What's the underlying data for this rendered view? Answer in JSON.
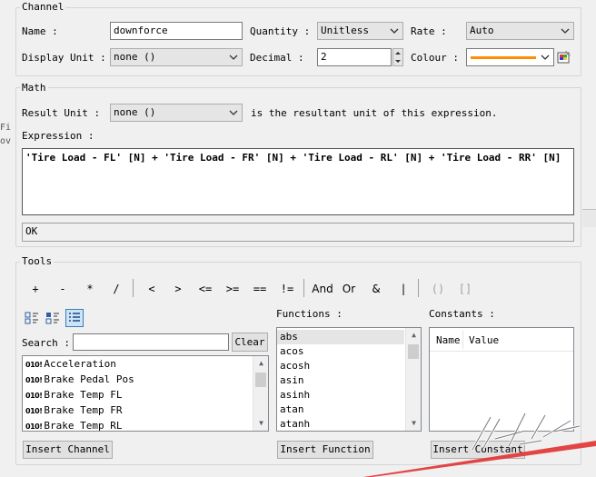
{
  "channel": {
    "group_title": "Channel",
    "name_label": "Name :",
    "name_value": "downforce",
    "quantity_label": "Quantity :",
    "quantity_value": "Unitless",
    "rate_label": "Rate :",
    "rate_value": "Auto",
    "display_unit_label": "Display Unit :",
    "display_unit_value": "none ()",
    "decimal_label": "Decimal :",
    "decimal_value": "2",
    "colour_label": "Colour :",
    "colour_value": "#ff8c00"
  },
  "math": {
    "group_title": "Math",
    "result_unit_label": "Result Unit :",
    "result_unit_value": "none ()",
    "result_unit_suffix": "is the resultant unit of this expression.",
    "expression_label": "Expression :",
    "expression_value": "'Tire Load - FL' [N] + 'Tire Load - FR' [N] + 'Tire Load - RL' [N] + 'Tire Load - RR' [N]",
    "status_value": "OK"
  },
  "tools": {
    "group_title": "Tools",
    "operators": [
      "+",
      "-",
      "*",
      "/",
      "<",
      ">",
      "<=",
      ">=",
      "==",
      "!=",
      "And",
      "Or",
      "&",
      "|",
      "()",
      "[]"
    ],
    "search_label": "Search :",
    "search_value": "",
    "clear_label": "Clear",
    "channels": [
      "Acceleration",
      "Brake Pedal Pos",
      "Brake Temp FL",
      "Brake Temp FR",
      "Brake Temp RL"
    ],
    "channel_icon_text": "010!",
    "insert_channel_label": "Insert Channel",
    "functions_label": "Functions :",
    "functions": [
      "abs",
      "acos",
      "acosh",
      "asin",
      "asinh",
      "atan",
      "atanh"
    ],
    "insert_function_label": "Insert Function",
    "constants_label": "Constants :",
    "constants_headers": [
      "Name",
      "Value"
    ],
    "insert_constant_label": "Insert Constant"
  }
}
